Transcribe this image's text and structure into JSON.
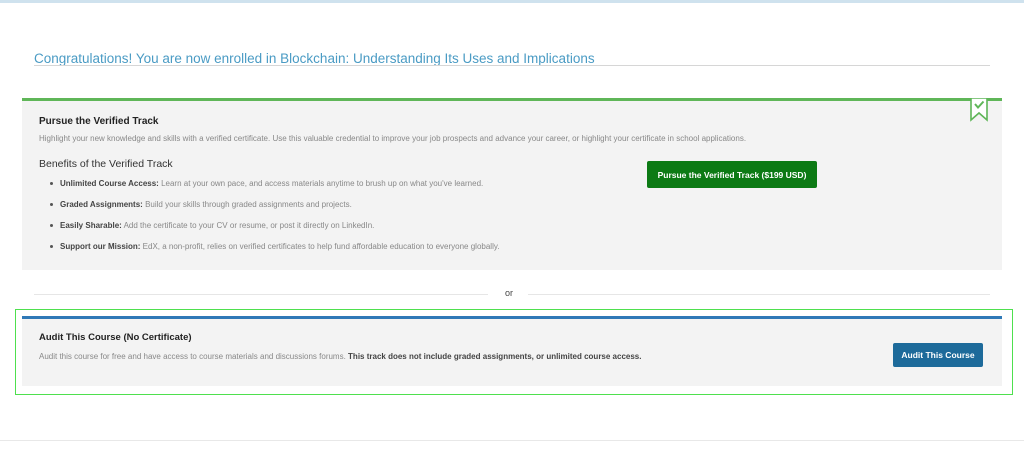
{
  "header": {
    "enrollment_message": "Congratulations! You are now enrolled in Blockchain: Understanding Its Uses and Implications"
  },
  "verified_track": {
    "title": "Pursue the Verified Track",
    "description": "Highlight your new knowledge and skills with a verified certificate. Use this valuable credential to improve your job prospects and advance your career, or highlight your certificate in school applications.",
    "benefits_title": "Benefits of the Verified Track",
    "benefits": [
      {
        "label": "Unlimited Course Access:",
        "text": "Learn at your own pace, and access materials anytime to brush up on what you've learned."
      },
      {
        "label": "Graded Assignments:",
        "text": "Build your skills through graded assignments and projects."
      },
      {
        "label": "Easily Sharable:",
        "text": "Add the certificate to your CV or resume, or post it directly on LinkedIn."
      },
      {
        "label": "Support our Mission:",
        "text": "EdX, a non-profit, relies on verified certificates to help fund affordable education to everyone globally."
      }
    ],
    "button_label": "Pursue the Verified Track ($199 USD)",
    "ribbon_icon": "verified-ribbon-icon",
    "accent_color": "#5fb658",
    "button_color": "#0c7a14"
  },
  "divider": {
    "or_text": "or"
  },
  "audit_track": {
    "title": "Audit This Course (No Certificate)",
    "description_plain": "Audit this course for free and have access to course materials and discussions forums.",
    "description_bold": "This track does not include graded assignments, or unlimited course access.",
    "button_label": "Audit This Course",
    "accent_color": "#2f79b7",
    "button_color": "#1d6a9a",
    "highlight_color": "#4ee04e"
  }
}
